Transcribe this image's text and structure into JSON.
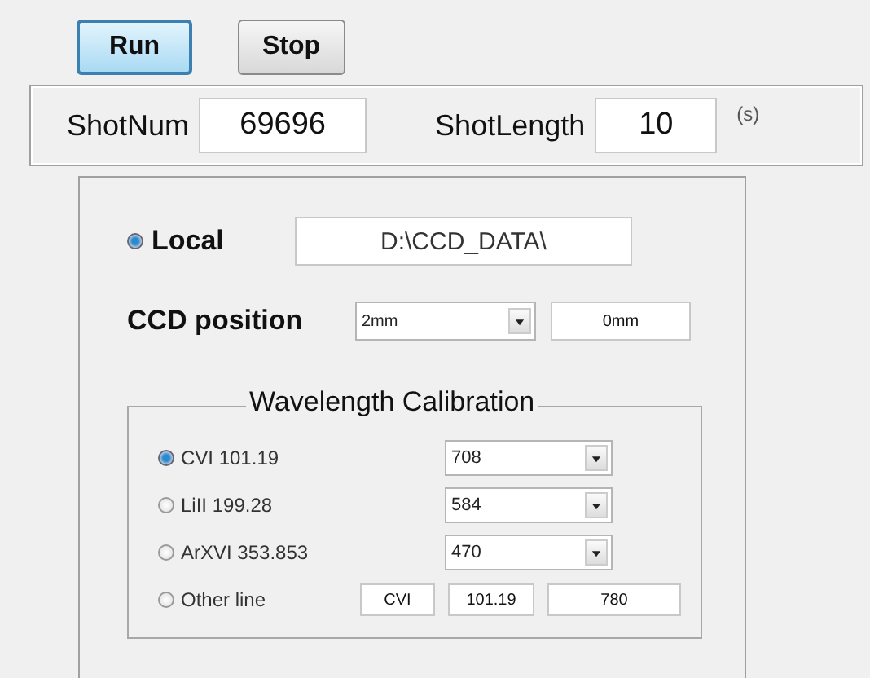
{
  "buttons": [
    {
      "label": "Run",
      "highlighted": true
    },
    {
      "label": "Stop",
      "highlighted": false
    }
  ],
  "shot": {
    "num_label": "ShotNum",
    "num_value": "69696",
    "length_label": "ShotLength",
    "length_value": "10",
    "length_unit": "(s)"
  },
  "source": {
    "label": "Local",
    "selected": true,
    "path": "D:\\CCD_DATA\\"
  },
  "ccd_position": {
    "label": "CCD position",
    "dropdown": "2mm",
    "value": "0mm"
  },
  "calibration": {
    "title": "Wavelength Calibration",
    "lines": [
      {
        "label": "CVI 101.19",
        "selected": true,
        "kind": "dropdown",
        "value": "708"
      },
      {
        "label": "LiII 199.28",
        "selected": false,
        "kind": "dropdown",
        "value": "584"
      },
      {
        "label": "ArXVI 353.853",
        "selected": false,
        "kind": "dropdown",
        "value": "470"
      },
      {
        "label": "Other line",
        "selected": false,
        "kind": "fields",
        "fields": [
          "CVI",
          "101.19",
          "780"
        ]
      }
    ]
  }
}
